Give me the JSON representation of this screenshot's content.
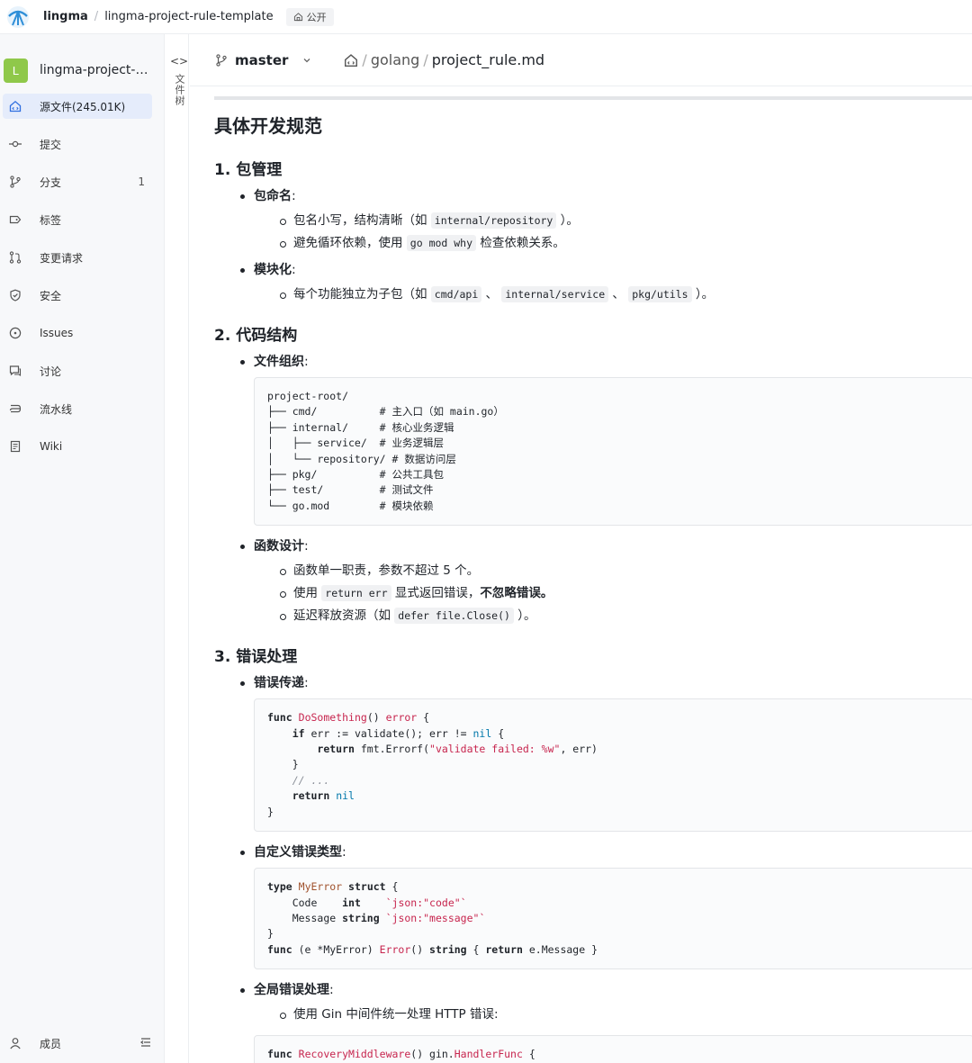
{
  "topbar": {
    "org": "lingma",
    "separator": "/",
    "repo": "lingma-project-rule-template",
    "visibility": "公开"
  },
  "sidebar": {
    "repo_initial": "L",
    "repo_name": "lingma-project-rul...",
    "items": [
      {
        "label": "源文件(245.01K)",
        "icon": "code-home-icon",
        "active": true
      },
      {
        "label": "提交",
        "icon": "commit-icon"
      },
      {
        "label": "分支",
        "icon": "branch-icon",
        "count": "1"
      },
      {
        "label": "标签",
        "icon": "tag-icon"
      },
      {
        "label": "变更请求",
        "icon": "merge-request-icon"
      },
      {
        "label": "安全",
        "icon": "shield-icon"
      },
      {
        "label": "Issues",
        "icon": "issue-icon"
      },
      {
        "label": "讨论",
        "icon": "discussion-icon"
      },
      {
        "label": "流水线",
        "icon": "pipeline-icon"
      },
      {
        "label": "Wiki",
        "icon": "wiki-icon"
      }
    ],
    "members_label": "成员"
  },
  "filetree": {
    "toggle": "<>",
    "label": "文件树"
  },
  "pathbar": {
    "branch": "master",
    "path": [
      "golang",
      "project_rule.md"
    ],
    "separator": "/"
  },
  "doc": {
    "title": "具体开发规范",
    "s1": {
      "heading": "1. 包管理",
      "i1": {
        "label": "包命名",
        "colon": ":"
      },
      "i1a_pre": "包名小写，结构清晰（如 ",
      "i1a_code": "internal/repository",
      "i1a_post": " ）。",
      "i1b_pre": "避免循环依赖，使用 ",
      "i1b_code": "go mod why",
      "i1b_post": " 检查依赖关系。",
      "i2": {
        "label": "模块化",
        "colon": ":"
      },
      "i2a_pre": "每个功能独立为子包（如 ",
      "i2a_c1": "cmd/api",
      "i2a_sep1": " 、 ",
      "i2a_c2": "internal/service",
      "i2a_sep2": " 、 ",
      "i2a_c3": "pkg/utils",
      "i2a_post": " ）。"
    },
    "s2": {
      "heading": "2. 代码结构",
      "i1": {
        "label": "文件组织",
        "colon": ":"
      },
      "tree": [
        "project-root/",
        "├── cmd/          # 主入口（如 main.go）",
        "├── internal/     # 核心业务逻辑",
        "│   ├── service/  # 业务逻辑层",
        "│   └── repository/ # 数据访问层",
        "├── pkg/          # 公共工具包",
        "├── test/         # 测试文件",
        "└── go.mod        # 模块依赖"
      ],
      "i2": {
        "label": "函数设计",
        "colon": ":"
      },
      "i2a": "函数单一职责，参数不超过 5 个。",
      "i2b_pre": "使用 ",
      "i2b_code": "return err",
      "i2b_mid": " 显式返回错误，",
      "i2b_strong": "不忽略错误。",
      "i2c_pre": "延迟释放资源（如 ",
      "i2c_code": "defer file.Close()",
      "i2c_post": " ）。"
    },
    "s3": {
      "heading": "3. 错误处理",
      "i1": {
        "label": "错误传递",
        "colon": ":"
      },
      "code1": {
        "l1_kw": "func",
        "l1_fn": "DoSomething",
        "l1_rest": "() ",
        "l1_err": "error",
        "l1_end": " {",
        "l2_kw": "if",
        "l2_mid": " err := validate(); err != ",
        "l2_nil": "nil",
        "l2_end": " {",
        "l3_kw": "return",
        "l3_mid": " fmt.Errorf(",
        "l3_str": "\"validate failed: %w\"",
        "l3_end": ", err)",
        "l4": "}",
        "l5": "// ...",
        "l6_kw": "return",
        "l6_nil": "nil",
        "l7": "}"
      },
      "i2": {
        "label": "自定义错误类型",
        "colon": ":"
      },
      "code2": {
        "l1_kw": "type",
        "l1_name": "MyError",
        "l1_kw2": "struct",
        "l1_end": " {",
        "l2_field": "Code",
        "l2_type": "int",
        "l2_tag": "`json:\"code\"`",
        "l3_field": "Message",
        "l3_type": "string",
        "l3_tag": "`json:\"message\"`",
        "l4": "}",
        "l5_kw": "func",
        "l5_recv": " (e *MyError) ",
        "l5_fn": "Error",
        "l5_mid": "() ",
        "l5_type": "string",
        "l5_end1": " { ",
        "l5_ret": "return",
        "l5_end2": " e.Message }"
      },
      "i3": {
        "label": "全局错误处理",
        "colon": ":"
      },
      "i3a": "使用 Gin 中间件统一处理 HTTP 错误:",
      "code3": {
        "l1_kw": "func",
        "l1_fn": "RecoveryMiddleware",
        "l1_mid": "() gin.",
        "l1_fn2": "HandlerFunc",
        "l1_end": " {"
      }
    }
  }
}
